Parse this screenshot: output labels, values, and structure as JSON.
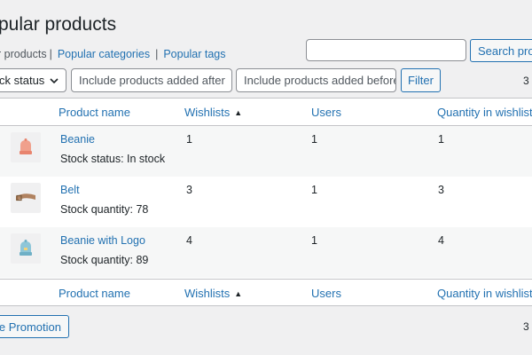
{
  "page": {
    "title": "pular products"
  },
  "subnav": {
    "current": "r products",
    "links": [
      "Popular categories",
      "Popular tags"
    ]
  },
  "search": {
    "value": "",
    "placeholder": "",
    "button_label": "Search products"
  },
  "filters": {
    "stock_status_label": "ck status",
    "added_after_placeholder": "Include products added after",
    "added_before_placeholder": "Include products added before",
    "filter_label": "Filter"
  },
  "items_count": {
    "top": "3",
    "bottom": "3"
  },
  "table": {
    "columns": [
      "Product name",
      "Wishlists",
      "Users",
      "Quantity in wishlist"
    ],
    "rows": [
      {
        "name": "Beanie",
        "detail": "Stock status: In stock",
        "wishlists": "1",
        "users": "1",
        "quantity": "1",
        "icon": "beanie-icon"
      },
      {
        "name": "Belt",
        "detail": "Stock quantity: 78",
        "wishlists": "3",
        "users": "1",
        "quantity": "3",
        "icon": "belt-icon"
      },
      {
        "name": "Beanie with Logo",
        "detail": "Stock quantity: 89",
        "wishlists": "4",
        "users": "1",
        "quantity": "4",
        "icon": "beanie-with-logo-icon"
      }
    ]
  },
  "promo": {
    "label": "ate Promotion"
  },
  "colors": {
    "accent": "#2271b1",
    "background": "#f0f0f1",
    "text": "#1d2327"
  }
}
